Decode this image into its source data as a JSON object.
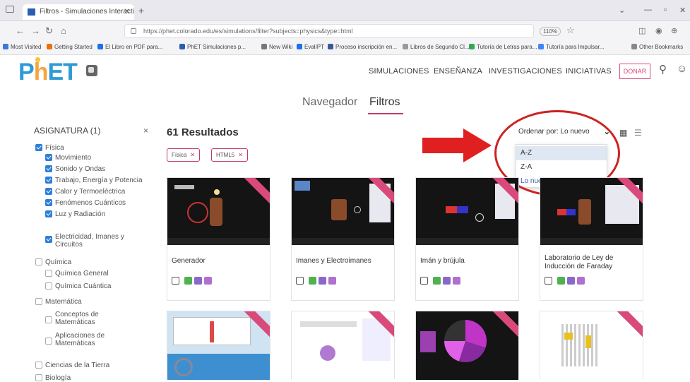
{
  "browser": {
    "tab_title": "Filtros - Simulaciones Interactiv",
    "tab_close": "✕",
    "new_tab": "+",
    "url": "https://phet.colorado.edu/es/simulations/filter?subjects=physics&type=html",
    "zoom": "110%",
    "bookmarks": [
      {
        "label": "Most Visited",
        "color": "#3c78d8"
      },
      {
        "label": "Getting Started",
        "color": "#e8710a"
      },
      {
        "label": "El Libro en PDF para...",
        "color": "#1a73e8"
      },
      {
        "label": "PhET Simulaciones p...",
        "color": "#2a5db0"
      },
      {
        "label": "New Wiki",
        "color": "#777777"
      },
      {
        "label": "EvalIPT",
        "color": "#1a73e8"
      },
      {
        "label": "Proceso inscripción en...",
        "color": "#3b5998"
      },
      {
        "label": "Libros de Segundo Cl...",
        "color": "#999999"
      },
      {
        "label": "Tutoría de Letras para...",
        "color": "#34a853"
      },
      {
        "label": "Tutoría para Impulsar...",
        "color": "#4285f4"
      },
      {
        "label": "Other Bookmarks",
        "color": "#888888"
      }
    ]
  },
  "header": {
    "logo": {
      "p": "P",
      "h": "h",
      "et": "ET"
    },
    "nav": [
      "SIMULACIONES",
      "ENSEÑANZA",
      "INVESTIGACIONES",
      "INICIATIVAS"
    ],
    "donate": "DONAR"
  },
  "subtabs": {
    "navigator": "Navegador",
    "filters": "Filtros"
  },
  "sidebar": {
    "title": "ASIGNATURA (1)",
    "clear": "×",
    "items": [
      {
        "label": "Física",
        "checked": true,
        "level": 0
      },
      {
        "label": "Movimiento",
        "checked": true,
        "level": 1
      },
      {
        "label": "Sonido y Ondas",
        "checked": true,
        "level": 1
      },
      {
        "label": "Trabajo, Energía y Potencia",
        "checked": true,
        "level": 1
      },
      {
        "label": "Calor y Termoeléctrica",
        "checked": true,
        "level": 1
      },
      {
        "label": "Fenómenos Cuánticos",
        "checked": true,
        "level": 1
      },
      {
        "label": "Luz y Radiación",
        "checked": true,
        "level": 1
      },
      {
        "label": "Electricidad, Imanes y Circuitos",
        "checked": true,
        "level": 1
      },
      {
        "label": "Química",
        "checked": false,
        "level": 0
      },
      {
        "label": "Química General",
        "checked": false,
        "level": 1
      },
      {
        "label": "Química Cuántica",
        "checked": false,
        "level": 1
      },
      {
        "label": "Matemática",
        "checked": false,
        "level": 0
      },
      {
        "label": "Conceptos de Matemáticas",
        "checked": false,
        "level": 1
      },
      {
        "label": "Aplicaciones de Matemáticas",
        "checked": false,
        "level": 1
      },
      {
        "label": "Ciencias de la Tierra",
        "checked": false,
        "level": 0
      },
      {
        "label": "Biología",
        "checked": false,
        "level": 0
      }
    ]
  },
  "results": {
    "count_label": "61 Resultados",
    "chips": [
      {
        "label": "Física",
        "x": "✕"
      },
      {
        "label": "HTML5",
        "x": "✕"
      }
    ]
  },
  "sort": {
    "label": "Ordenar por: Lo nuevo",
    "options": [
      "A-Z",
      "Z-A",
      "Lo nuevo"
    ],
    "highlighted": "A-Z"
  },
  "cards": [
    {
      "title": "Generador",
      "light": false
    },
    {
      "title": "Imanes y Electroimanes",
      "light": false
    },
    {
      "title": "Imán y brújula",
      "light": false
    },
    {
      "title": "Laboratorio de Ley de Inducción de Faraday",
      "light": false
    },
    {
      "title": "",
      "light": true
    },
    {
      "title": "",
      "light": true
    },
    {
      "title": "",
      "light": false
    },
    {
      "title": "",
      "light": true
    }
  ],
  "colors": {
    "accent": "#c23b6b",
    "arrow": "#e02020",
    "checkbox": "#2f7fd9",
    "logo_blue": "#2c9bd6",
    "logo_orange": "#f4a640"
  }
}
